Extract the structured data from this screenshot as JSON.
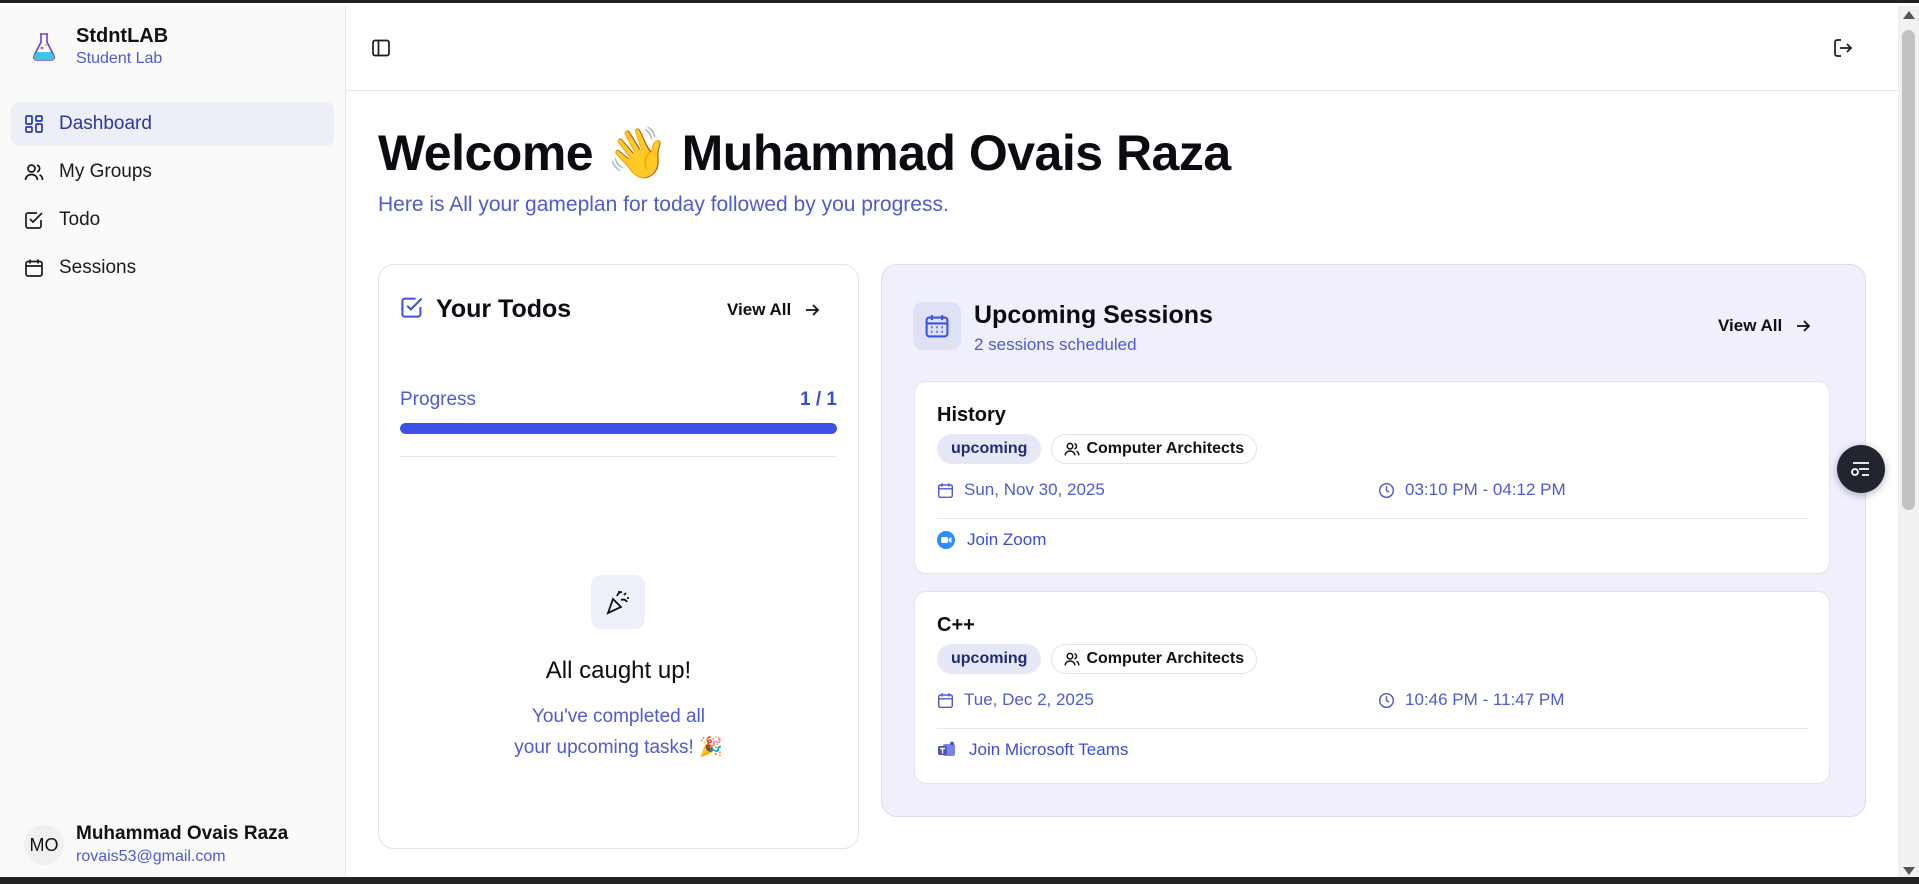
{
  "brand": {
    "name": "StdntLAB",
    "subtitle": "Student Lab",
    "logo_icon": "flask-logo-icon"
  },
  "sidebar": {
    "items": [
      {
        "label": "Dashboard",
        "icon": "dashboard-icon",
        "active": true
      },
      {
        "label": "My Groups",
        "icon": "users-icon",
        "active": false
      },
      {
        "label": "Todo",
        "icon": "check-square-icon",
        "active": false
      },
      {
        "label": "Sessions",
        "icon": "calendar-icon",
        "active": false
      }
    ]
  },
  "user": {
    "initials": "MO",
    "name": "Muhammad Ovais Raza",
    "email": "rovais53@gmail.com"
  },
  "header": {
    "welcome": "Welcome 👋 Muhammad Ovais Raza",
    "subtitle": "Here is All your gameplan for today followed by you progress."
  },
  "todos": {
    "title": "Your Todos",
    "view_all": "View All",
    "progress_label": "Progress",
    "progress_count": "1 / 1",
    "progress_fraction": 1.0,
    "empty_title": "All caught up!",
    "empty_line1": "You've completed all",
    "empty_line2": "your upcoming tasks! 🎉"
  },
  "sessions": {
    "title": "Upcoming Sessions",
    "subtitle": "2 sessions scheduled",
    "view_all": "View All",
    "items": [
      {
        "title": "History",
        "status": "upcoming",
        "group": "Computer Architects",
        "date": "Sun, Nov 30, 2025",
        "time": "03:10 PM - 04:12 PM",
        "join": "Join Zoom",
        "join_icon": "zoom-icon"
      },
      {
        "title": "C++",
        "status": "upcoming",
        "group": "Computer Architects",
        "date": "Tue, Dec 2, 2025",
        "time": "10:46 PM - 11:47 PM",
        "join": "Join Microsoft Teams",
        "join_icon": "teams-icon"
      }
    ]
  },
  "colors": {
    "accent": "#3d51e4",
    "accent_text": "#4e5bd1",
    "sessions_bg": "#eff0fb"
  }
}
